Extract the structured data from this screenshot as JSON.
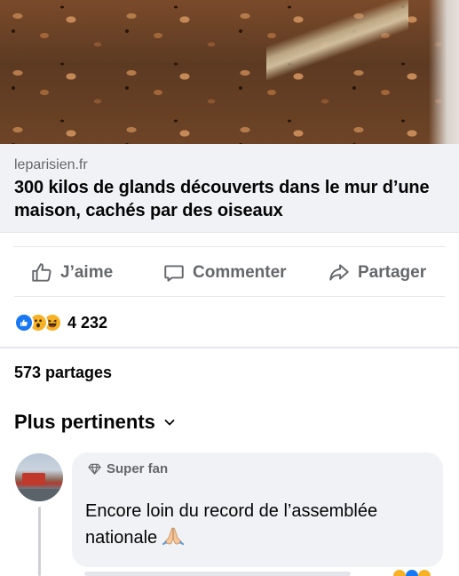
{
  "post": {
    "link": {
      "domain": "leparisien.fr",
      "title": "300 kilos de glands découverts dans le mur d’une maison, cachés par des oiseaux"
    },
    "actions": {
      "like": "J’aime",
      "comment": "Commenter",
      "share": "Partager"
    },
    "reactions": {
      "icons": [
        "like-icon",
        "wow-icon",
        "haha-icon"
      ],
      "count": "4 232"
    },
    "shares": "573 partages"
  },
  "comments": {
    "sort_label": "Plus pertinents",
    "items": [
      {
        "badge": "Super fan",
        "text": "Encore loin du record de l’assemblée nationale",
        "emoji": "folded-hands-icon"
      }
    ]
  },
  "colors": {
    "link_bg": "#f0f2f5",
    "secondary_text": "#65676b",
    "like_blue": "#1877f2",
    "reaction_yellow": "#f7b125"
  }
}
